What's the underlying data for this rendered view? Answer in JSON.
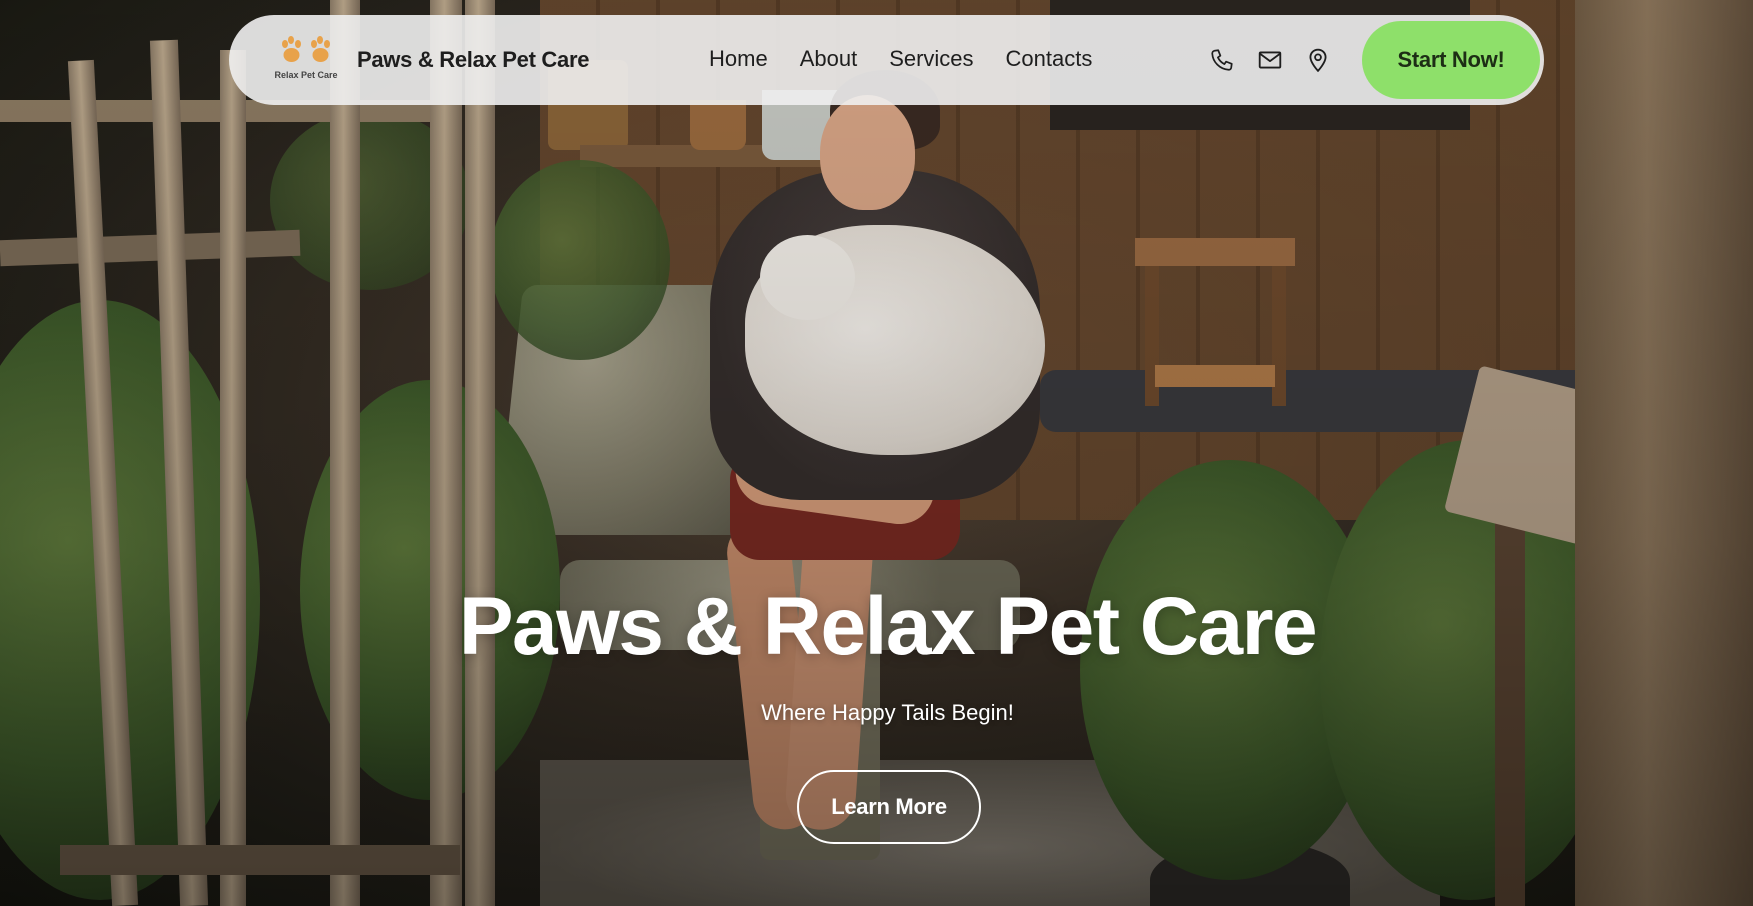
{
  "navbar": {
    "logo_text": "Relax  Pet Care",
    "brand_name": "Paws & Relax Pet Care",
    "links": [
      {
        "label": "Home"
      },
      {
        "label": "About"
      },
      {
        "label": "Services"
      },
      {
        "label": "Contacts"
      }
    ],
    "contact_icons": [
      "phone-icon",
      "mail-icon",
      "location-pin-icon"
    ],
    "cta_label": "Start Now!"
  },
  "hero": {
    "title": "Paws & Relax Pet Care",
    "subtitle": "Where Happy Tails Begin!",
    "button_label": "Learn More"
  },
  "colors": {
    "accent_green": "#8ee06a",
    "navbar_bg": "#f0f0f0",
    "text_dark": "#1e1e1e",
    "logo_paw": "#e8a24a"
  }
}
